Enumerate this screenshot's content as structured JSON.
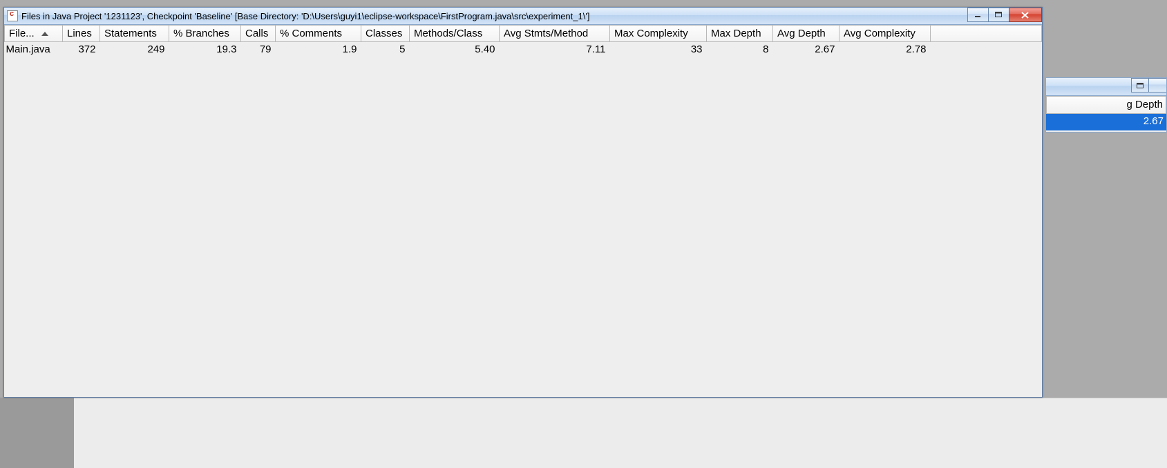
{
  "window": {
    "title": "Files in Java Project '1231123', Checkpoint 'Baseline'  [Base Directory: 'D:\\Users\\guyi1\\eclipse-workspace\\FirstProgram.java\\src\\experiment_1\\']"
  },
  "columns": {
    "file": "File...",
    "lines": "Lines",
    "statements": "Statements",
    "pct_branches": "% Branches",
    "calls": "Calls",
    "pct_comments": "% Comments",
    "classes": "Classes",
    "methods_per_class": "Methods/Class",
    "avg_stmts_per_method": "Avg Stmts/Method",
    "max_complexity": "Max Complexity",
    "max_depth": "Max Depth",
    "avg_depth": "Avg Depth",
    "avg_complexity": "Avg Complexity"
  },
  "rows": [
    {
      "file": "Main.java",
      "lines": "372",
      "statements": "249",
      "pct_branches": "19.3",
      "calls": "79",
      "pct_comments": "1.9",
      "classes": "5",
      "methods_per_class": "5.40",
      "avg_stmts_per_method": "7.11",
      "max_complexity": "33",
      "max_depth": "8",
      "avg_depth": "2.67",
      "avg_complexity": "2.78"
    }
  ],
  "bg_window": {
    "header_fragment": "g Depth",
    "value": "2.67"
  }
}
